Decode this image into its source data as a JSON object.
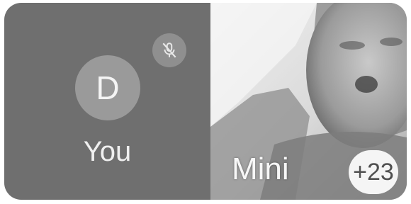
{
  "self_tile": {
    "avatar_initial": "D",
    "name": "You",
    "mute_icon": "mic-off-icon"
  },
  "remote_tile": {
    "name": "Mini",
    "overflow_count": "+23"
  },
  "colors": {
    "self_tile_bg": "#6f6f6f",
    "avatar_bg": "#9a9a9a",
    "badge_bg": "#f5f5f5"
  }
}
